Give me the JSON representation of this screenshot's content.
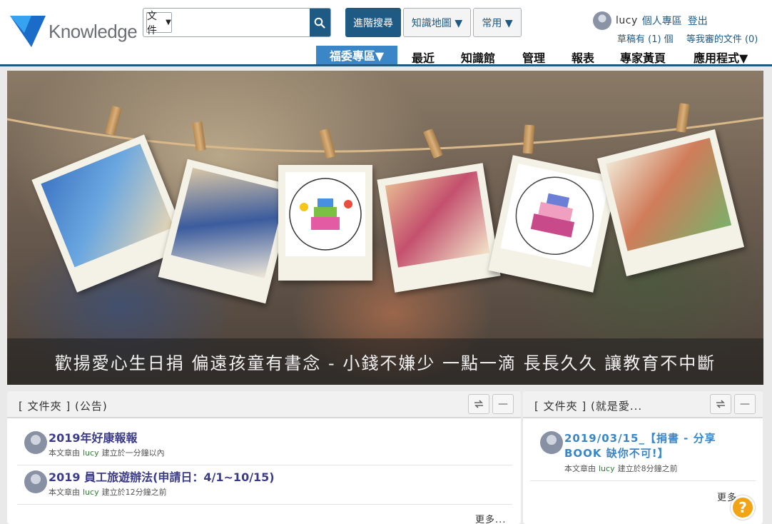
{
  "brand": {
    "name": "Knowledge"
  },
  "search": {
    "type_label": "文件",
    "placeholder": ""
  },
  "toolbar": {
    "advanced_search": "進階搜尋",
    "knowledge_map": "知識地圖 ▼",
    "common": "常用 ▼"
  },
  "user": {
    "name": "lucy",
    "personal_area": "個人專區",
    "logout": "登出",
    "drafts": "草稿有 (1) 個",
    "pending_review": "等我審的文件 (0)"
  },
  "nav": {
    "active": "福委專區▼",
    "items": [
      "最近",
      "知識館",
      "管理",
      "報表",
      "專家黃頁",
      "應用程式▼"
    ]
  },
  "banner": {
    "caption": "歡揚愛心生日捐 偏遠孩童有書念 - 小錢不嫌少 一點一滴 長長久久 讓教育不中斷"
  },
  "panels": {
    "left": {
      "title": "[ 文件夾 ] (公告)",
      "items": [
        {
          "title": "2019年好康報報",
          "meta_prefix": "本文章由",
          "author": "lucy",
          "meta_suffix": "建立於一分鐘以內"
        },
        {
          "title": "2019 員工旅遊辦法(申請日：4/1~10/15)",
          "meta_prefix": "本文章由",
          "author": "lucy",
          "meta_suffix": "建立於12分鐘之前"
        }
      ],
      "more": "更多..."
    },
    "right": {
      "title": "[ 文件夾 ] (就是愛...",
      "items": [
        {
          "title": "2019/03/15_【捐書 - 分享BOOK 缺你不可!】",
          "meta_prefix": "本文章由",
          "author": "lucy",
          "meta_suffix": "建立於8分鐘之前"
        }
      ],
      "more": "更多"
    }
  },
  "icons": {
    "search": "search-icon",
    "refresh": "refresh-icon",
    "minimize": "minimize-icon",
    "help": "help-icon"
  },
  "help": {
    "label": "?"
  },
  "colors": {
    "primary": "#1f5a85",
    "nav_active": "#3a86c6",
    "help": "#f3a316"
  }
}
